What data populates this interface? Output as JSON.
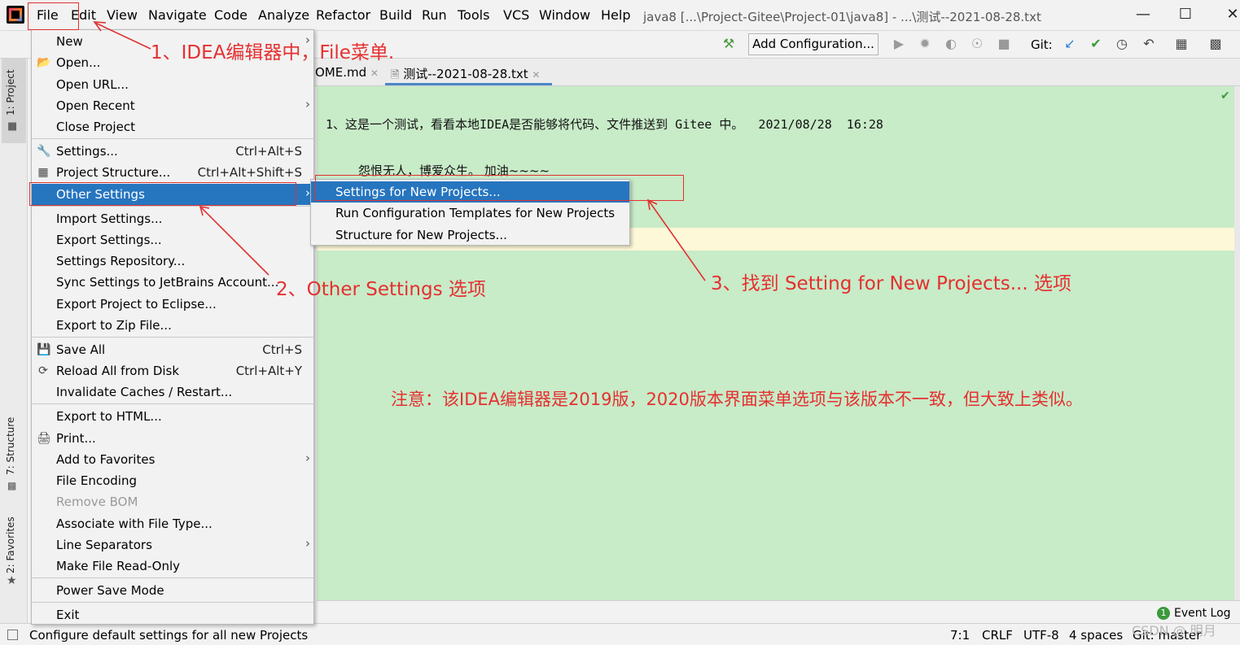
{
  "menubar": {
    "items": [
      "File",
      "Edit",
      "View",
      "Navigate",
      "Code",
      "Analyze",
      "Refactor",
      "Build",
      "Run",
      "Tools",
      "VCS",
      "Window",
      "Help"
    ],
    "title": "java8 [...\\Project-Gitee\\Project-01\\java8] - ...\\测试--2021-08-28.txt"
  },
  "toolbar": {
    "add_config": "Add Configuration...",
    "git_label": "Git:"
  },
  "tabs": [
    {
      "label": "OME.md"
    },
    {
      "label": "测试--2021-08-28.txt"
    }
  ],
  "left_strip": {
    "project": "1: Project",
    "structure": "7: Structure",
    "favorites": "2: Favorites"
  },
  "editor": {
    "line1": "1、这是一个测试，看看本地IDEA是否能够将代码、文件推送到 Gitee 中。  2021/08/28  16:28",
    "line2": "怨恨无人，博爱众生。 加油~~~~"
  },
  "file_menu": [
    {
      "label": "New",
      "arrow": true
    },
    {
      "label": "Open...",
      "icon": "folder-icon"
    },
    {
      "label": "Open URL..."
    },
    {
      "label": "Open Recent",
      "arrow": true
    },
    {
      "label": "Close Project"
    },
    {
      "label": "Settings...",
      "shortcut": "Ctrl+Alt+S",
      "icon": "wrench-icon"
    },
    {
      "label": "Project Structure...",
      "shortcut": "Ctrl+Alt+Shift+S",
      "icon": "project-structure-icon"
    },
    {
      "label": "Other Settings",
      "arrow": true,
      "selected": true
    },
    {
      "label": "Import Settings..."
    },
    {
      "label": "Export Settings..."
    },
    {
      "label": "Settings Repository..."
    },
    {
      "label": "Sync Settings to JetBrains Account..."
    },
    {
      "label": "Export Project to Eclipse..."
    },
    {
      "label": "Export to Zip File..."
    },
    {
      "label": "Save All",
      "shortcut": "Ctrl+S",
      "icon": "save-icon"
    },
    {
      "label": "Reload All from Disk",
      "shortcut": "Ctrl+Alt+Y",
      "icon": "reload-icon"
    },
    {
      "label": "Invalidate Caches / Restart..."
    },
    {
      "label": "Export to HTML..."
    },
    {
      "label": "Print...",
      "icon": "print-icon"
    },
    {
      "label": "Add to Favorites",
      "arrow": true
    },
    {
      "label": "File Encoding"
    },
    {
      "label": "Remove BOM",
      "disabled": true
    },
    {
      "label": "Associate with File Type..."
    },
    {
      "label": "Line Separators",
      "arrow": true
    },
    {
      "label": "Make File Read-Only"
    },
    {
      "label": "Power Save Mode"
    },
    {
      "label": "Exit"
    }
  ],
  "submenu": [
    {
      "label": "Settings for New Projects...",
      "selected": true
    },
    {
      "label": "Run Configuration Templates for New Projects"
    },
    {
      "label": "Structure for New Projects..."
    }
  ],
  "annotations": {
    "a1": "1、IDEA编辑器中，File菜单.",
    "a2": "2、Other Settings 选项",
    "a3": "3、找到 Setting for New Projects... 选项",
    "note": "注意：该IDEA编辑器是2019版，2020版本界面菜单选项与该版本不一致，但大致上类似。"
  },
  "statusbar": {
    "hint": "Configure default settings for all new Projects",
    "position": "7:1",
    "line_sep": "CRLF",
    "encoding": "UTF-8",
    "indent": "4 spaces",
    "git": "Git: master",
    "event_log": "Event Log",
    "event_count": "1"
  },
  "watermark": "CSDN @ 明月"
}
